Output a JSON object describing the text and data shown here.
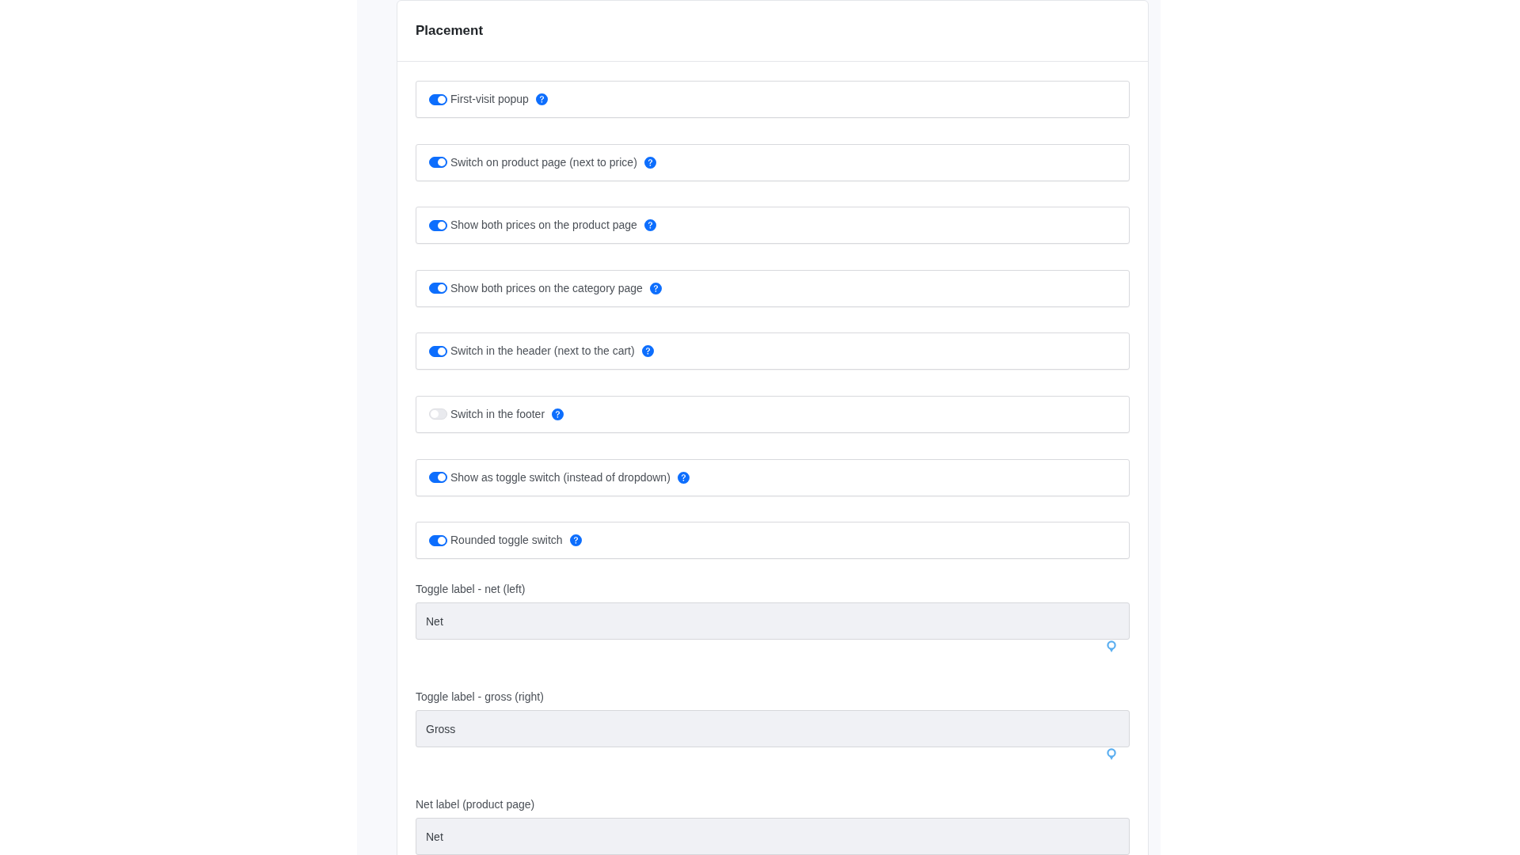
{
  "section": {
    "title": "Placement"
  },
  "toggles": [
    {
      "label": "First-visit popup",
      "on": true
    },
    {
      "label": "Switch on product page (next to price)",
      "on": true
    },
    {
      "label": "Show both prices on the product page",
      "on": true
    },
    {
      "label": "Show both prices on the category page",
      "on": true
    },
    {
      "label": "Switch in the header (next to the cart)",
      "on": true
    },
    {
      "label": "Switch in the footer",
      "on": false
    },
    {
      "label": "Show as toggle switch (instead of dropdown)",
      "on": true
    },
    {
      "label": "Rounded toggle switch",
      "on": true
    }
  ],
  "fields": [
    {
      "label": "Toggle label - net (left)",
      "value": "Net"
    },
    {
      "label": "Toggle label - gross (right)",
      "value": "Gross"
    },
    {
      "label": "Net label (product page)",
      "value": "Net"
    }
  ]
}
